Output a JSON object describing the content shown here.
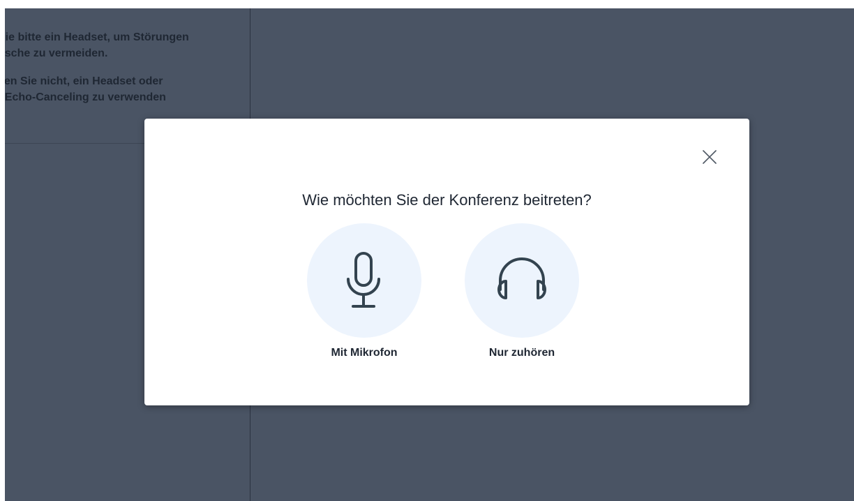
{
  "side_panel": {
    "paragraphs": [
      {
        "line1": "Sie bitte ein Headset, um Störungen",
        "line2": "usche zu vermeiden."
      },
      {
        "line1": "sen Sie nicht, ein Headset oder",
        "line2": "t Echo-Canceling zu verwenden"
      }
    ]
  },
  "modal": {
    "title": "Wie möchten Sie der Konferenz beitreten?",
    "close_icon": "close-icon",
    "options": [
      {
        "label": "Mit Mikrofon",
        "icon": "microphone-icon"
      },
      {
        "label": "Nur zuhören",
        "icon": "headphones-icon"
      }
    ]
  },
  "colors": {
    "backdrop": "#4a5464",
    "modal_bg": "#ffffff",
    "option_circle": "#edf4fd",
    "icon_stroke": "#33434f",
    "text": "#1f2733"
  }
}
